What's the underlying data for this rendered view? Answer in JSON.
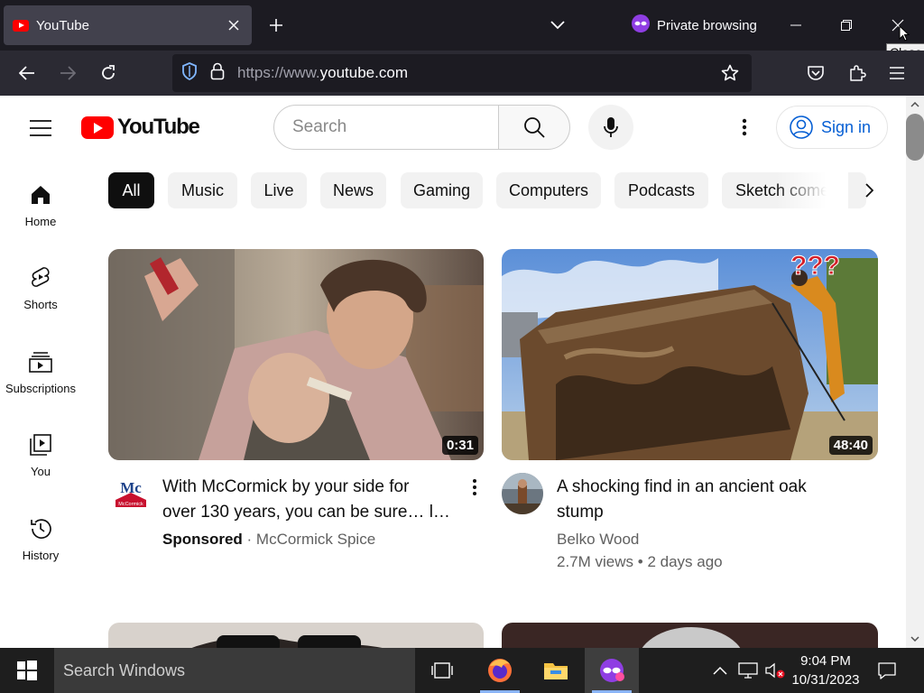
{
  "browser": {
    "tab": {
      "title": "YouTube"
    },
    "private_label": "Private browsing",
    "tooltip": "Close",
    "url_prefix": "https://www.",
    "url_domain": "youtube.com",
    "colors": {
      "tab_bg": "#42414d",
      "strip_bg": "#1c1b22",
      "nav_bg": "#2b2a33",
      "private_purple": "#8f3ee3"
    }
  },
  "youtube": {
    "logo_text": "YouTube",
    "search_placeholder": "Search",
    "sign_in_label": "Sign in",
    "sidebar": [
      {
        "label": "Home",
        "icon": "home-icon"
      },
      {
        "label": "Shorts",
        "icon": "shorts-icon"
      },
      {
        "label": "Subscriptions",
        "icon": "subscriptions-icon"
      },
      {
        "label": "You",
        "icon": "you-icon"
      },
      {
        "label": "History",
        "icon": "history-icon"
      }
    ],
    "chips": [
      "All",
      "Music",
      "Live",
      "News",
      "Gaming",
      "Computers",
      "Podcasts",
      "Sketch come"
    ],
    "videos": [
      {
        "title_line1": "With McCormick by your side for",
        "title_line2": "over 130 years, you can be sure… l…",
        "duration": "0:31",
        "sponsored_label": "Sponsored",
        "separator": " · ",
        "channel": "McCormick Spice",
        "avatar_text": "Mc",
        "avatar_sub": "McCormick"
      },
      {
        "title_line1": "A shocking find in an ancient oak",
        "title_line2": "stump",
        "duration": "48:40",
        "channel": "Belko Wood",
        "views": "2.7M views",
        "separator": " • ",
        "age": "2 days ago",
        "overlay_text": "???"
      }
    ],
    "colors": {
      "brand_red": "#ff0000",
      "link_blue": "#065fd4",
      "chip_bg": "#f2f2f2"
    }
  },
  "taskbar": {
    "search_placeholder": "Search Windows",
    "time": "9:04 PM",
    "date": "10/31/2023"
  }
}
